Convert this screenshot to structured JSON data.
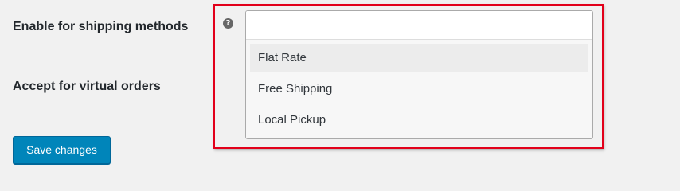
{
  "settings": {
    "shipping_methods_label": "Enable for shipping methods",
    "virtual_orders_label": "Accept for virtual orders",
    "help_icon_glyph": "?"
  },
  "shipping_select": {
    "value": "",
    "options": [
      {
        "label": "Flat Rate",
        "highlighted": true
      },
      {
        "label": "Free Shipping",
        "highlighted": false
      },
      {
        "label": "Local Pickup",
        "highlighted": false
      }
    ]
  },
  "actions": {
    "save_label": "Save changes"
  },
  "colors": {
    "primary_button": "#0085ba",
    "highlight_border": "#e2001a",
    "page_background": "#f1f1f1"
  }
}
